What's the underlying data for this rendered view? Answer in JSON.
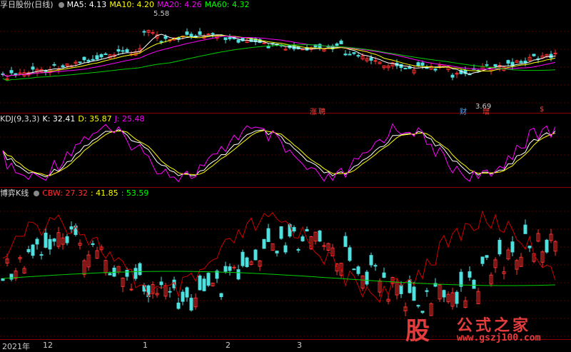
{
  "main": {
    "title": "孚日股份(日线)",
    "ma_labels": [
      {
        "text": "MA5: 4.13",
        "color": "#ffffff"
      },
      {
        "text": "MA10: 4.20",
        "color": "#ffff00"
      },
      {
        "text": "MA20: 4.26",
        "color": "#ff00ff"
      },
      {
        "text": "MA60: 4.32",
        "color": "#00ff00"
      }
    ],
    "high_label": "5.58",
    "low_label": "3.69",
    "events": [
      {
        "text": "涨",
        "color": "#ff4040"
      },
      {
        "text": "聘",
        "color": "#ff4040"
      },
      {
        "text": "财",
        "color": "#4da6ff"
      },
      {
        "text": "增",
        "color": "#ff4040"
      },
      {
        "text": "$",
        "color": "#ff4040"
      }
    ]
  },
  "kdj": {
    "title": "KDJ(9,3,3)",
    "labels": [
      {
        "text": "K: 32.41",
        "color": "#ffffff"
      },
      {
        "text": "D: 35.87",
        "color": "#ffff00"
      },
      {
        "text": "J: 25.48",
        "color": "#ff00ff"
      }
    ]
  },
  "cbw": {
    "title": "博弈K线",
    "labels": [
      {
        "text": "CBW: 27.32",
        "color": "#ff3030"
      },
      {
        "text": ": 41.85",
        "color": "#ffff00"
      },
      {
        "text": ": 53.59",
        "color": "#00ff00"
      }
    ]
  },
  "dates": [
    "2021年",
    "12",
    "1",
    "2",
    "3"
  ],
  "watermark": {
    "glyph": "股",
    "title": "公式之家",
    "url": "www.gszj100.com"
  },
  "colors": {
    "up": "#ff3030",
    "down": "#4fe0e0",
    "ma60": "#00cc00"
  }
}
